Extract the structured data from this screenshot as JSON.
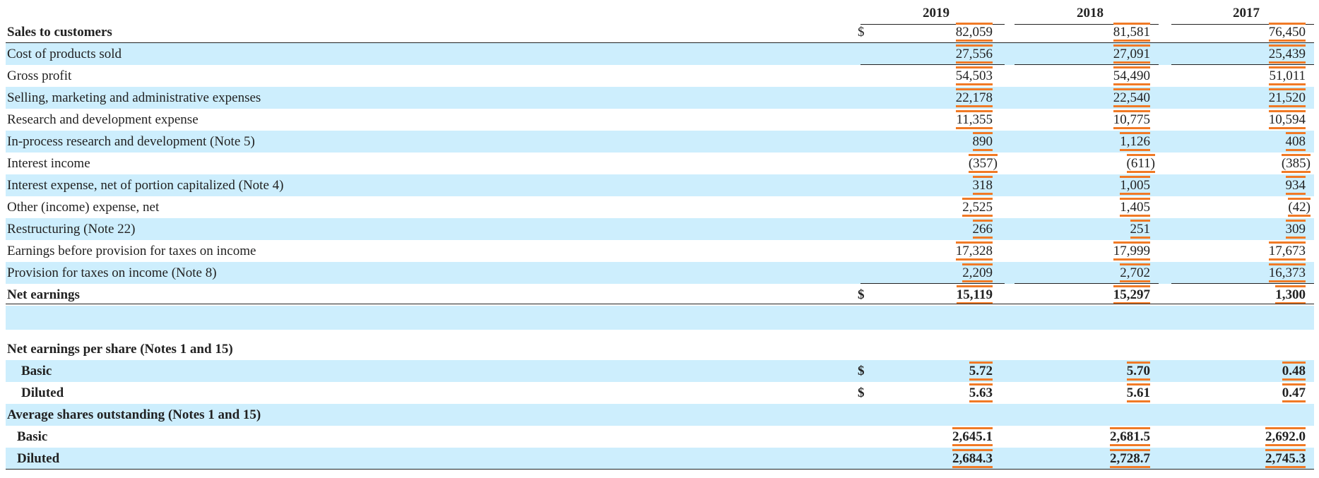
{
  "header": {
    "years": [
      "2019",
      "2018",
      "2017"
    ]
  },
  "rows": [
    {
      "label": "Sales to customers",
      "bold": true,
      "currency": "$",
      "values": [
        "82,059",
        "81,581",
        "76,450"
      ],
      "shaded": false
    },
    {
      "label": "Cost of products sold",
      "values": [
        "27,556",
        "27,091",
        "25,439"
      ],
      "shaded": true
    },
    {
      "label": "Gross profit",
      "values": [
        "54,503",
        "54,490",
        "51,011"
      ],
      "shaded": false
    },
    {
      "label": "Selling, marketing and administrative expenses",
      "values": [
        "22,178",
        "22,540",
        "21,520"
      ],
      "shaded": true
    },
    {
      "label": "Research and development expense",
      "values": [
        "11,355",
        "10,775",
        "10,594"
      ],
      "shaded": false
    },
    {
      "label": "In-process research and development (Note 5)",
      "values": [
        "890",
        "1,126",
        "408"
      ],
      "shaded": true
    },
    {
      "label": "Interest income",
      "values": [
        "(357)",
        "(611)",
        "(385)"
      ],
      "shaded": false
    },
    {
      "label": "Interest expense, net of portion capitalized (Note 4)",
      "values": [
        "318",
        "1,005",
        "934"
      ],
      "shaded": true
    },
    {
      "label": "Other (income) expense, net",
      "values": [
        "2,525",
        "1,405",
        "(42)"
      ],
      "shaded": false
    },
    {
      "label": "Restructuring (Note 22)",
      "values": [
        "266",
        "251",
        "309"
      ],
      "shaded": true
    },
    {
      "label": "Earnings before provision for taxes on income",
      "values": [
        "17,328",
        "17,999",
        "17,673"
      ],
      "shaded": false
    },
    {
      "label": "Provision for taxes on income (Note 8)",
      "values": [
        "2,209",
        "2,702",
        "16,373"
      ],
      "shaded": true
    },
    {
      "label": "Net earnings",
      "bold": true,
      "currency": "$",
      "values": [
        "15,119",
        "15,297",
        "1,300"
      ],
      "shaded": false
    }
  ],
  "per_share": {
    "heading": "Net earnings per share (Notes 1 and 15)",
    "basic": {
      "label": "Basic",
      "currency": "$",
      "values": [
        "5.72",
        "5.70",
        "0.48"
      ]
    },
    "diluted": {
      "label": "Diluted",
      "currency": "$",
      "values": [
        "5.63",
        "5.61",
        "0.47"
      ]
    }
  },
  "shares": {
    "heading": "Average shares outstanding (Notes 1 and 15)",
    "basic": {
      "label": "Basic",
      "values": [
        "2,645.1",
        "2,681.5",
        "2,692.0"
      ]
    },
    "diluted": {
      "label": "Diluted",
      "values": [
        "2,684.3",
        "2,728.7",
        "2,745.3"
      ]
    }
  },
  "colors": {
    "row_shade": "#cdeefd",
    "highlight_rule": "#f07a26",
    "text": "#222222"
  }
}
